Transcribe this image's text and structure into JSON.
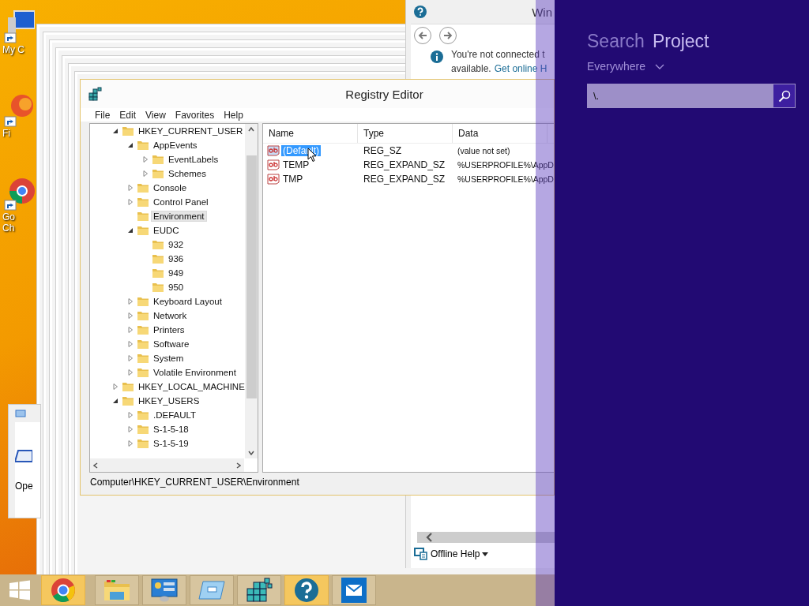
{
  "desktop": {
    "icons": [
      {
        "lines": [
          "My C"
        ]
      },
      {
        "lines": [
          "Fi"
        ]
      },
      {
        "lines": [
          "Go",
          "Ch"
        ]
      }
    ]
  },
  "background_window": {
    "label": "Ope"
  },
  "help_window": {
    "title": "Win",
    "message_line_1": "You're not connected t",
    "message_line_2": "available.",
    "link": "Get online H",
    "footer_button": "Offline Help"
  },
  "registry_editor": {
    "title": "Registry Editor",
    "menu": [
      "File",
      "Edit",
      "View",
      "Favorites",
      "Help"
    ],
    "tree": [
      {
        "label": "HKEY_CURRENT_USER",
        "expanded": true,
        "selected": false,
        "children": [
          {
            "label": "AppEvents",
            "expanded": true,
            "selected": false,
            "children": [
              {
                "label": "EventLabels",
                "expanded": false,
                "selected": false
              },
              {
                "label": "Schemes",
                "expanded": false,
                "selected": false
              }
            ]
          },
          {
            "label": "Console",
            "expanded": false,
            "selected": false
          },
          {
            "label": "Control Panel",
            "expanded": false,
            "selected": false
          },
          {
            "label": "Environment",
            "selected": true
          },
          {
            "label": "EUDC",
            "expanded": true,
            "selected": false,
            "children": [
              {
                "label": "932",
                "selected": false
              },
              {
                "label": "936",
                "selected": false
              },
              {
                "label": "949",
                "selected": false
              },
              {
                "label": "950",
                "selected": false
              }
            ]
          },
          {
            "label": "Keyboard Layout",
            "expanded": false,
            "selected": false
          },
          {
            "label": "Network",
            "expanded": false,
            "selected": false
          },
          {
            "label": "Printers",
            "expanded": false,
            "selected": false
          },
          {
            "label": "Software",
            "expanded": false,
            "selected": false
          },
          {
            "label": "System",
            "expanded": false,
            "selected": false
          },
          {
            "label": "Volatile Environment",
            "expanded": false,
            "selected": false
          }
        ]
      },
      {
        "label": "HKEY_LOCAL_MACHINE",
        "expanded": false,
        "selected": false
      },
      {
        "label": "HKEY_USERS",
        "expanded": true,
        "selected": false,
        "children": [
          {
            "label": ".DEFAULT",
            "expanded": false,
            "selected": false
          },
          {
            "label": "S-1-5-18",
            "expanded": false,
            "selected": false
          },
          {
            "label": "S-1-5-19",
            "expanded": false,
            "selected": false
          }
        ]
      }
    ],
    "columns": [
      "Name",
      "Type",
      "Data"
    ],
    "values": [
      {
        "name": "(Default)",
        "type": "REG_SZ",
        "data": "(value not set)",
        "selected": true
      },
      {
        "name": "TEMP",
        "type": "REG_EXPAND_SZ",
        "data": "%USERPROFILE%\\AppD",
        "selected": false
      },
      {
        "name": "TMP",
        "type": "REG_EXPAND_SZ",
        "data": "%USERPROFILE%\\AppD",
        "selected": false
      }
    ],
    "status_bar": "Computer\\HKEY_CURRENT_USER\\Environment"
  },
  "taskbar": {
    "items": [
      {
        "kind": "start",
        "active": false
      },
      {
        "kind": "browser",
        "active": true
      },
      {
        "kind": "folder",
        "active": false
      },
      {
        "kind": "control-panel",
        "active": false
      },
      {
        "kind": "window",
        "active": false
      },
      {
        "kind": "registry",
        "active": false
      },
      {
        "kind": "help",
        "active": true
      },
      {
        "kind": "mail",
        "active": false
      }
    ]
  },
  "search_pane": {
    "title": "Search",
    "title_overlap": "Project",
    "scope": "Everywhere",
    "query": "\\."
  }
}
